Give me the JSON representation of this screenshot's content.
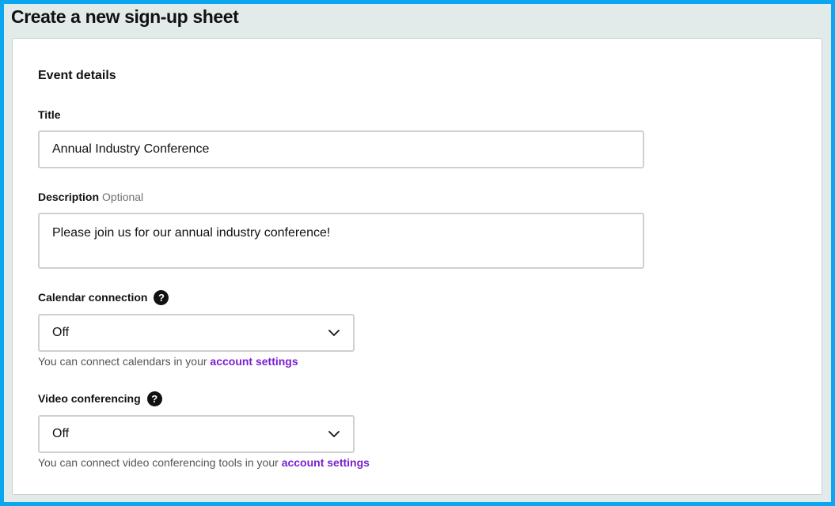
{
  "page": {
    "title": "Create a new sign-up sheet"
  },
  "event_details": {
    "section_title": "Event details",
    "title_field": {
      "label": "Title",
      "value": "Annual Industry Conference"
    },
    "description_field": {
      "label": "Description",
      "optional_label": "Optional",
      "value": "Please join us for our annual industry conference!"
    },
    "calendar": {
      "label": "Calendar connection",
      "help_glyph": "?",
      "selected": "Off",
      "hint_text": "You can connect calendars in your ",
      "hint_link": "account settings"
    },
    "video": {
      "label": "Video conferencing",
      "help_glyph": "?",
      "selected": "Off",
      "hint_text": "You can connect video conferencing tools in your ",
      "hint_link": "account settings"
    }
  },
  "colors": {
    "frame": "#0aa6f0",
    "background": "#e3ebea",
    "link": "#7a1fd1"
  },
  "icons": [
    "help-icon",
    "chevron-down-icon"
  ]
}
